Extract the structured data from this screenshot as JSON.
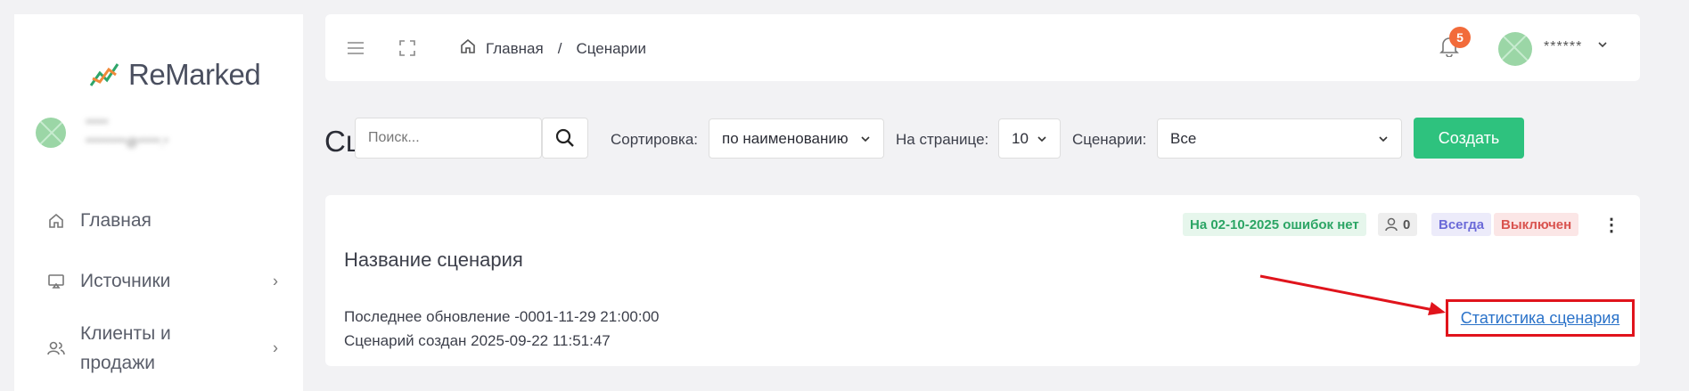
{
  "sidebar": {
    "logo_text": "ReMarked",
    "user_name": "*****",
    "user_email": "*********@*****.*",
    "items": [
      {
        "label": "Главная",
        "icon": "home-icon"
      },
      {
        "label": "Источники",
        "icon": "monitor-icon"
      },
      {
        "label": "Клиенты и продажи",
        "icon": "users-icon"
      }
    ]
  },
  "topbar": {
    "breadcrumb_home": "Главная",
    "breadcrumb_sep": "/",
    "breadcrumb_current": "Сценарии",
    "notifications_count": "5",
    "user_masked": "******"
  },
  "toolbar": {
    "page_title": "Сценарии",
    "search_placeholder": "Поиск...",
    "sort_label": "Сортировка:",
    "sort_value": "по наименованию",
    "per_page_label": "На странице:",
    "per_page_value": "10",
    "scenarios_label": "Сценарии:",
    "scenarios_value": "Все",
    "create_label": "Создать"
  },
  "card": {
    "status_ok": "На 02-10-2025 ошибок нет",
    "users_count": "0",
    "frequency": "Всегда",
    "state": "Выключен",
    "title": "Название сценария",
    "last_updated": "Последнее обновление -0001-11-29 21:00:00",
    "created": "Сценарий создан 2025-09-22 11:51:47",
    "stats_link": "Статистика сценария"
  },
  "colors": {
    "accent_green": "#2ec27e",
    "badge_orange": "#f26b3a",
    "link_blue": "#2a72c9",
    "highlight_red": "#e0141c"
  }
}
